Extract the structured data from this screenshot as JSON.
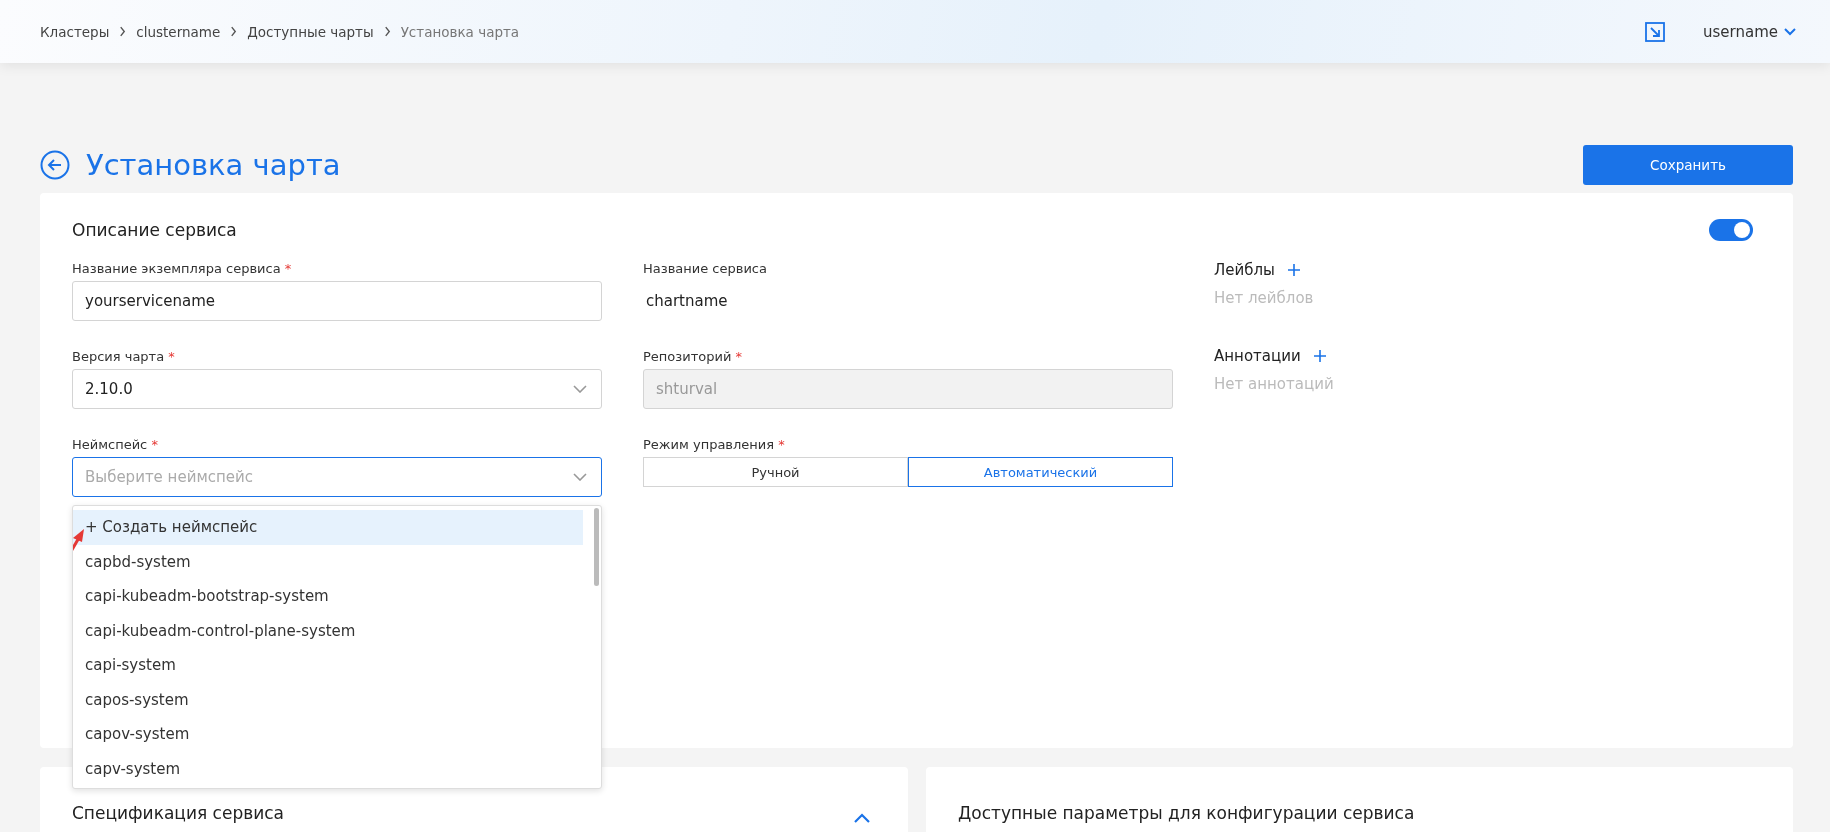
{
  "header": {
    "breadcrumbs": [
      {
        "label": "Кластеры"
      },
      {
        "label": "clustername"
      },
      {
        "label": "Доступные чарты"
      },
      {
        "label": "Установка чарта"
      }
    ],
    "user": "username"
  },
  "page": {
    "title": "Установка чарта",
    "save_button": "Сохранить"
  },
  "service_card": {
    "title": "Описание сервиса",
    "toggle_on": true,
    "left_fields": [
      {
        "kind": "input",
        "label": "Название экземпляра сервиса",
        "required_mark": "*",
        "value": "yourservicename",
        "focused": false
      },
      {
        "kind": "select",
        "label": "Версия чарта",
        "required_mark": "*",
        "value": "2.10.0",
        "focused": false
      },
      {
        "kind": "select",
        "label": "Неймспейс",
        "required_mark": "*",
        "placeholder": "Выберите неймспейс",
        "focused": true
      }
    ],
    "middle_fields": [
      {
        "kind": "text",
        "label": "Название сервиса",
        "value": "chartname"
      },
      {
        "kind": "disabled",
        "label": "Репозиторий",
        "required_mark": "*",
        "value": "shturval"
      },
      {
        "kind": "segmented",
        "label": "Режим управления",
        "required_mark": "*",
        "options": [
          {
            "label": "Ручной",
            "selected": false
          },
          {
            "label": "Автоматический",
            "selected": true
          }
        ]
      }
    ],
    "sections": [
      {
        "title": "Лейблы",
        "empty_text": "Нет лейблов"
      },
      {
        "title": "Аннотации",
        "empty_text": "Нет аннотаций"
      }
    ]
  },
  "namespace_dropdown": {
    "items": [
      {
        "label": "+ Создать неймспейс",
        "highlighted": true
      },
      {
        "label": "capbd-system",
        "highlighted": false
      },
      {
        "label": "capi-kubeadm-bootstrap-system",
        "highlighted": false
      },
      {
        "label": "capi-kubeadm-control-plane-system",
        "highlighted": false
      },
      {
        "label": "capi-system",
        "highlighted": false
      },
      {
        "label": "capos-system",
        "highlighted": false
      },
      {
        "label": "capov-system",
        "highlighted": false
      },
      {
        "label": "capv-system",
        "highlighted": false
      }
    ]
  },
  "spec_card": {
    "title": "Спецификация сервиса",
    "expanded": true
  },
  "params_card": {
    "title": "Доступные параметры для конфигурации сервиса"
  }
}
